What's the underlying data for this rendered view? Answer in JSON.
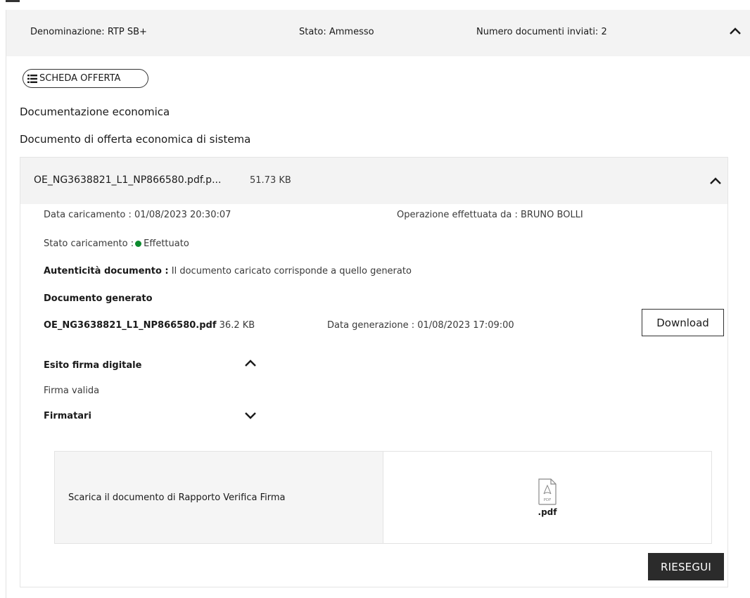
{
  "header": {
    "denominazione": "Denominazione: RTP SB+",
    "stato": "Stato: Ammesso",
    "numero_documenti": "Numero documenti inviati: 2"
  },
  "scheda_offerta_label": "SCHEDA OFFERTA",
  "documentazione_title": "Documentazione economica",
  "documento_title": "Documento di offerta economica di sistema",
  "file": {
    "name": "OE_NG3638821_L1_NP866580.pdf.p...",
    "size": "51.73 KB"
  },
  "details": {
    "data_caricamento": "Data caricamento : 01/08/2023 20:30:07",
    "operazione": "Operazione effettuata da : BRUNO BOLLI",
    "stato_caricamento_label": "Stato caricamento :",
    "stato_caricamento_value": "Effettuato",
    "autenticita_label": "Autenticità documento :",
    "autenticita_value": " Il documento caricato corrisponde a quello generato",
    "documento_generato_label": "Documento generato",
    "generated_name": "OE_NG3638821_L1_NP866580.pdf",
    "generated_size": " 36.2 KB",
    "data_generazione": "Data generazione : 01/08/2023 17:09:00",
    "download_label": "Download",
    "esito_label": "Esito firma digitale",
    "firma_valida": "Firma valida",
    "firmatari_label": "Firmatari"
  },
  "verifica": {
    "text": "Scarica il documento di Rapporto Verifica Firma",
    "icon_text": "PDF",
    "ext": ".pdf"
  },
  "riesegui_label": "RIESEGUI",
  "colors": {
    "header_bg": "#f3f3f3",
    "status_green": "#0c8a2e",
    "dark_button": "#2b2b2b"
  },
  "icons": [
    "list-icon",
    "chevron-up-icon",
    "chevron-down-icon",
    "pdf-file-icon"
  ]
}
